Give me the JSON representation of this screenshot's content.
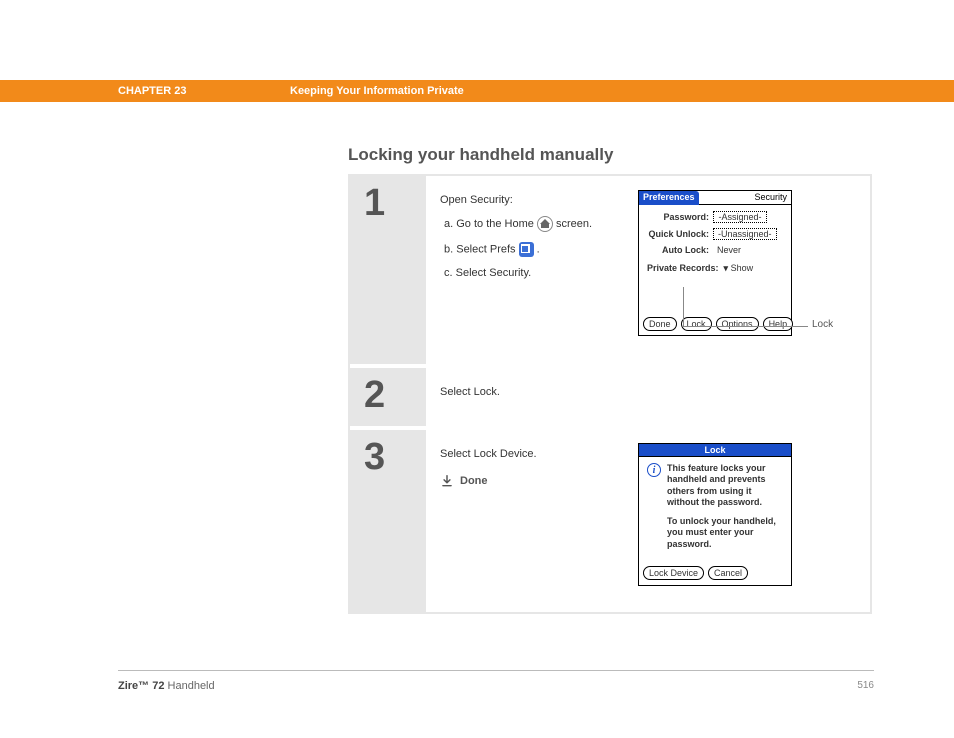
{
  "header": {
    "chapter": "CHAPTER 23",
    "title": "Keeping Your Information Private"
  },
  "section_title": "Locking your handheld manually",
  "steps": [
    {
      "num": "1",
      "lead": "Open Security:",
      "subs": {
        "a_prefix": "a.  Go to the Home ",
        "a_suffix": " screen.",
        "b_prefix": "b.  Select Prefs ",
        "b_suffix": ".",
        "c": "c.  Select Security."
      }
    },
    {
      "num": "2",
      "lead": "Select Lock."
    },
    {
      "num": "3",
      "lead": "Select Lock Device.",
      "done": "Done"
    }
  ],
  "prefs_screen": {
    "tb_left": "Preferences",
    "tb_right": "Security",
    "rows": {
      "password_lbl": "Password:",
      "password_val": "-Assigned-",
      "quick_lbl": "Quick Unlock:",
      "quick_val": "-Unassigned-",
      "auto_lbl": "Auto Lock:",
      "auto_val": "Never",
      "private_lbl": "Private Records:",
      "private_val": "Show"
    },
    "buttons": [
      "Done",
      "Lock",
      "Options",
      "Help"
    ],
    "callout": "Lock"
  },
  "lock_dialog": {
    "title": "Lock",
    "msg1": "This feature locks your handheld and prevents others from using it without the password.",
    "msg2": "To unlock your handheld, you must enter your password.",
    "buttons": [
      "Lock Device",
      "Cancel"
    ]
  },
  "footer": {
    "product_bold": "Zire™ 72",
    "product_rest": " Handheld",
    "page": "516"
  }
}
